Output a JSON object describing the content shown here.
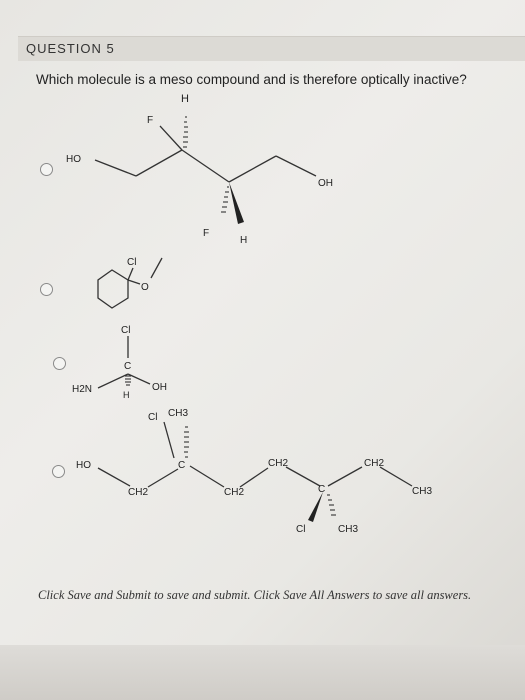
{
  "question": {
    "title": "QUESTION 5",
    "prompt": "Which molecule is a meso compound and is therefore optically inactive?"
  },
  "options": [
    {
      "labels": {
        "h_top": "H",
        "f_top": "F",
        "ho": "HO",
        "oh": "OH",
        "f_bottom": "F",
        "h_bottom": "H"
      }
    },
    {
      "labels": {
        "cl": "Cl",
        "o": "O"
      }
    },
    {
      "labels": {
        "cl": "Cl",
        "c": "C",
        "h2n": "H2N",
        "h": "H",
        "oh": "OH"
      }
    },
    {
      "labels": {
        "ho": "HO",
        "ch2_a": "CH2",
        "c1": "C",
        "cl_top": "Cl",
        "ch3_top": "CH3",
        "ch2_b": "CH2",
        "ch2_c": "CH2",
        "c2": "C",
        "ch2_d": "CH2",
        "ch3_right": "CH3",
        "cl_bottom": "Cl",
        "ch3_bottom": "CH3"
      }
    }
  ],
  "footer": {
    "text": "Click Save and Submit to save and submit. Click Save All Answers to save all answers."
  }
}
